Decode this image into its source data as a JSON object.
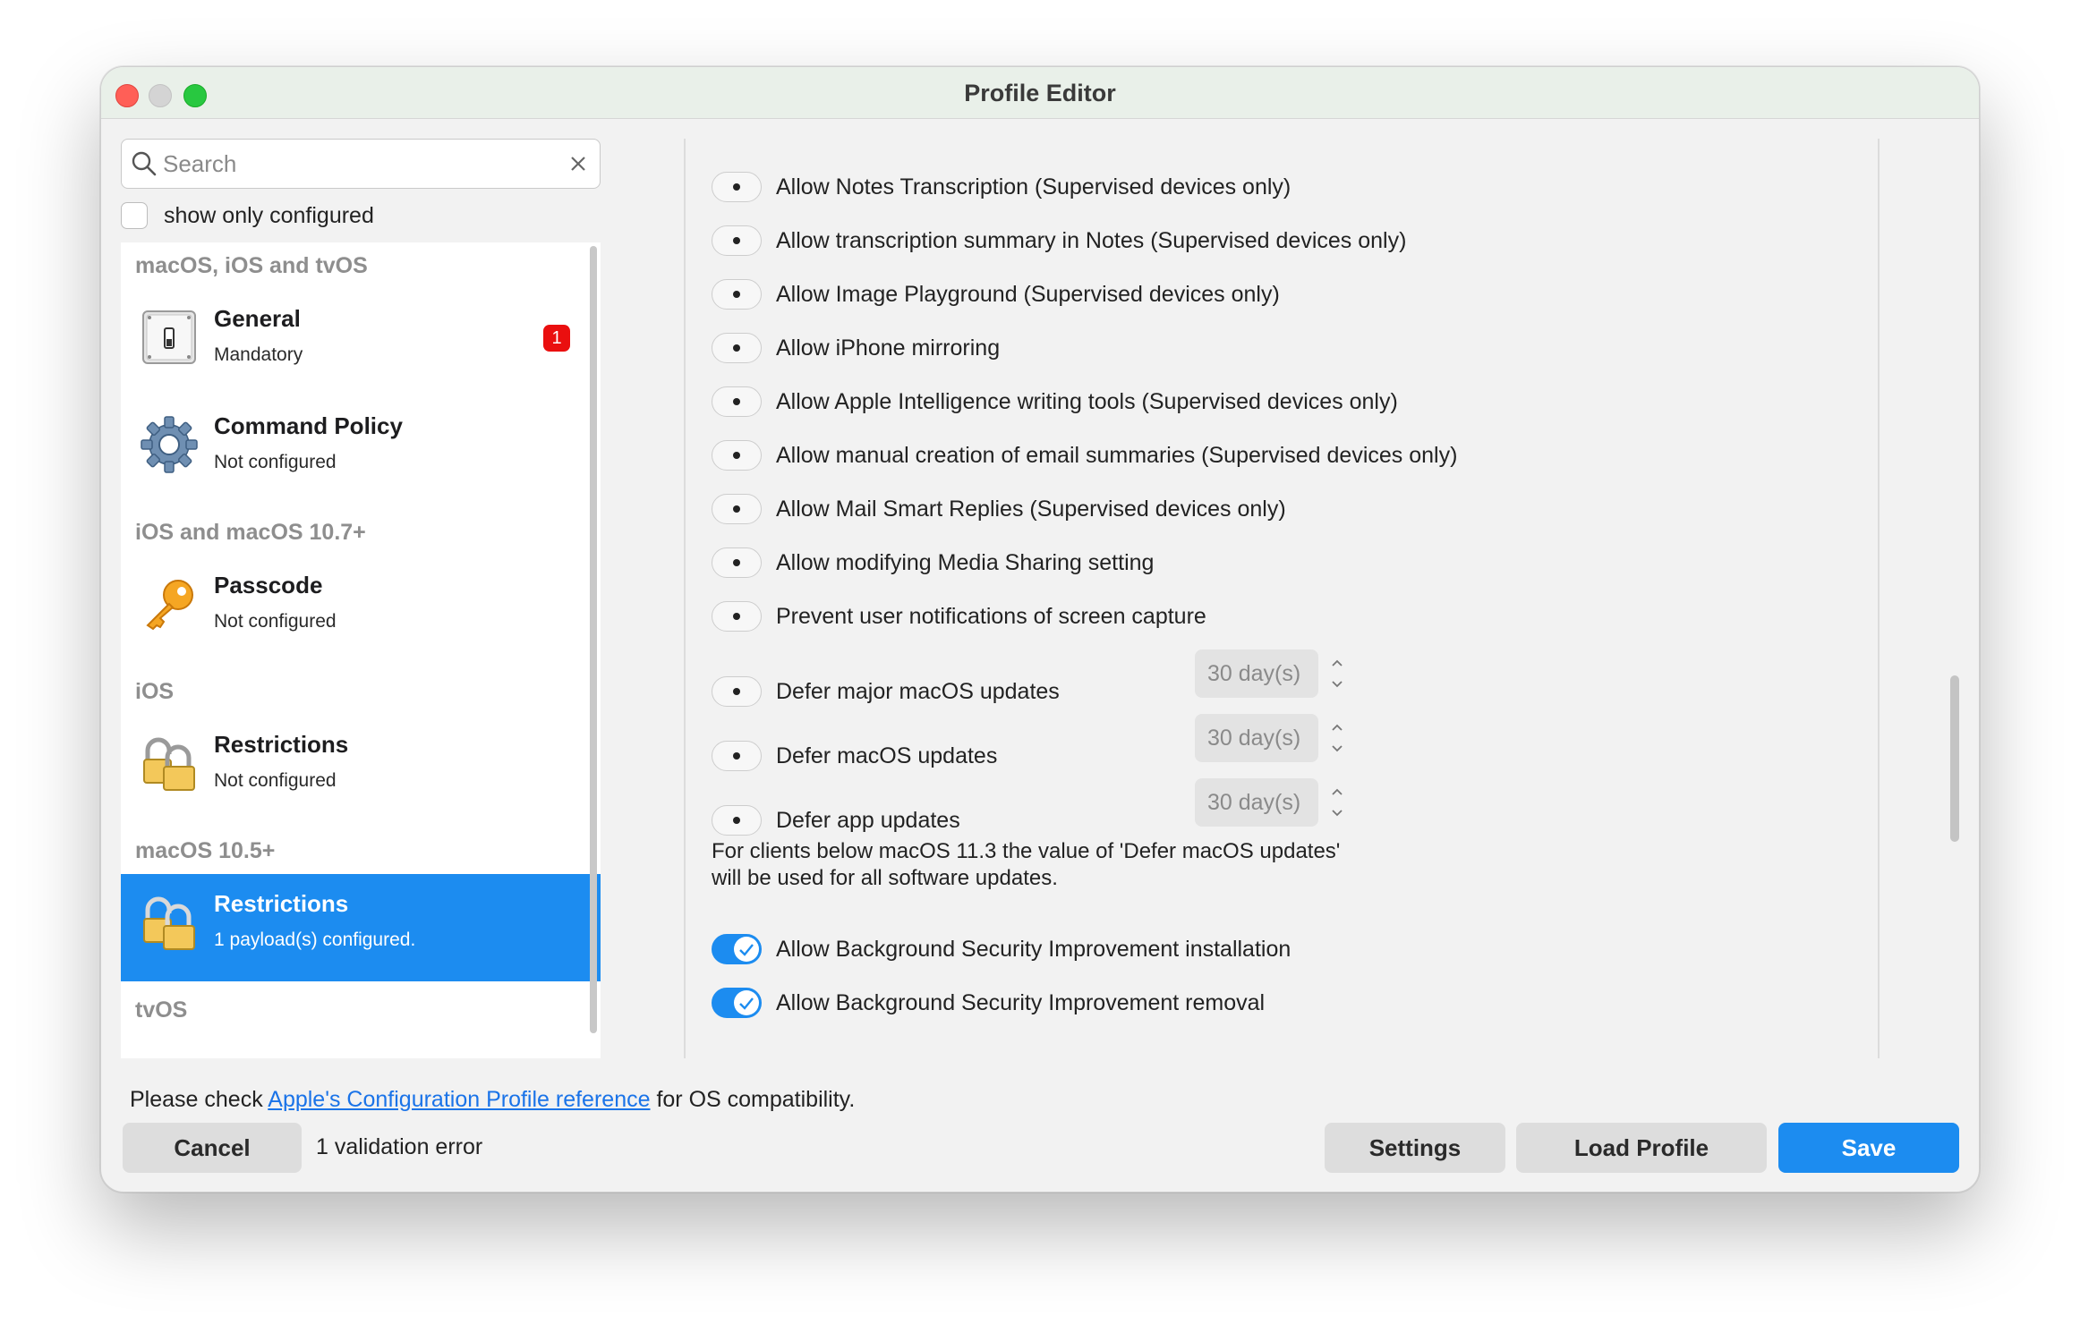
{
  "window": {
    "title": "Profile Editor"
  },
  "sidebar": {
    "search_placeholder": "Search",
    "show_only_configured_label": "show only configured",
    "groups": [
      {
        "header": "macOS, iOS and tvOS"
      },
      {
        "header": "iOS and macOS 10.7+"
      },
      {
        "header": "iOS"
      },
      {
        "header": "macOS 10.5+"
      },
      {
        "header": "tvOS"
      }
    ],
    "items": [
      {
        "title": "General",
        "subtitle": "Mandatory",
        "badge": "1",
        "icon": "switch-icon"
      },
      {
        "title": "Command Policy",
        "subtitle": "Not configured",
        "icon": "gear-icon"
      },
      {
        "title": "Passcode",
        "subtitle": "Not configured",
        "icon": "key-icon"
      },
      {
        "title": "Restrictions",
        "subtitle": "Not configured",
        "icon": "padlock-icon"
      },
      {
        "title": "Restrictions",
        "subtitle": "1 payload(s) configured.",
        "icon": "padlock-icon",
        "selected": true
      }
    ]
  },
  "options": [
    {
      "label": "Allow Notes Transcription (Supervised devices only)",
      "state": "unset"
    },
    {
      "label": "Allow transcription summary in Notes (Supervised devices only)",
      "state": "unset"
    },
    {
      "label": "Allow Image Playground (Supervised devices only)",
      "state": "unset"
    },
    {
      "label": "Allow iPhone mirroring",
      "state": "unset"
    },
    {
      "label": "Allow Apple Intelligence writing tools (Supervised devices only)",
      "state": "unset"
    },
    {
      "label": "Allow manual creation of email summaries (Supervised devices only)",
      "state": "unset"
    },
    {
      "label": "Allow Mail Smart Replies (Supervised devices only)",
      "state": "unset"
    },
    {
      "label": "Allow modifying Media Sharing setting",
      "state": "unset"
    },
    {
      "label": "Prevent user notifications of screen capture",
      "state": "unset"
    }
  ],
  "deferrals": [
    {
      "label": "Defer major macOS updates",
      "value": "30 day(s)"
    },
    {
      "label": "Defer macOS updates",
      "value": "30 day(s)"
    },
    {
      "label": "Defer app updates",
      "value": "30 day(s)"
    }
  ],
  "deferral_note_line1": "For clients below macOS 11.3 the value of 'Defer macOS updates'",
  "deferral_note_line2": "will be used for all software updates.",
  "bsi_options": [
    {
      "label": "Allow Background Security Improvement installation",
      "state": "on"
    },
    {
      "label": "Allow Background Security Improvement removal",
      "state": "on"
    }
  ],
  "footer": {
    "note_prefix": "Please check ",
    "link_text": "Apple's Configuration Profile reference",
    "note_suffix": " for OS compatibility.",
    "cancel_label": "Cancel",
    "validation_text": "1 validation error",
    "settings_label": "Settings",
    "load_profile_label": "Load Profile",
    "save_label": "Save"
  },
  "colors": {
    "accent": "#1c8cf0",
    "badge": "#ea0f0f",
    "link": "#1a73e8"
  }
}
